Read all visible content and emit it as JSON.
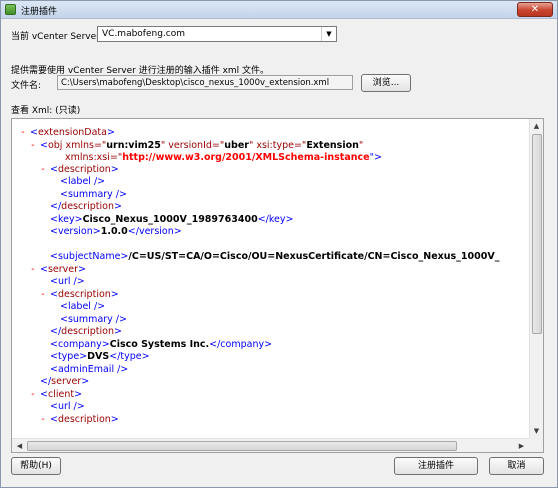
{
  "window": {
    "title": "注册插件",
    "close_glyph": "✕"
  },
  "server": {
    "label": "当前 vCenter Server:",
    "value": "VC.mabofeng.com"
  },
  "hint": "提供需要使用 vCenter Server 进行注册的输入插件 xml 文件。",
  "file": {
    "label": "文件名:",
    "path": "C:\\Users\\mabofeng\\Desktop\\cisco_nexus_1000v_extension.xml",
    "browse_label": "浏览..."
  },
  "view_label": "查看 Xml: (只读)",
  "xml_lines": [
    {
      "minus": "-",
      "tags": [
        "<",
        "extensionData",
        ">"
      ]
    },
    {
      "minus": "-",
      "obj": {
        "open": "<",
        "name": "obj",
        "a1": " xmlns=\"",
        "v1": "urn:vim25",
        "a2": "\" versionId=\"",
        "v2": "uber",
        "a3": "\" xsi:type=\"",
        "v3": "Extension",
        "end": "\""
      }
    },
    {
      "xmlns_xsi": {
        "attr": "xmlns:xsi=\"",
        "value": "http://www.w3.org/2001/XMLSchema-instance",
        "end": "\">"
      }
    },
    {
      "minus": "-",
      "tags": [
        "<",
        "description",
        ">"
      ]
    },
    {
      "text": "<label />"
    },
    {
      "text": "<summary />"
    },
    {
      "tags": [
        "</",
        "description",
        ">"
      ]
    },
    {
      "key": {
        "open": "<key>",
        "value": "Cisco_Nexus_1000V_1989763400",
        "close": "</key>"
      }
    },
    {
      "key": {
        "open": "<version>",
        "value": "1.0.0",
        "close": "</version>"
      }
    },
    {
      "key": {
        "open": "<subjectName>",
        "value": "/C=US/ST=CA/O=Cisco/OU=NexusCertificate/CN=Cisco_Nexus_1000V_",
        "close": ""
      }
    },
    {
      "minus": "-",
      "tags": [
        "<",
        "server",
        ">"
      ]
    },
    {
      "text": "<url />"
    },
    {
      "minus": "-",
      "tags": [
        "<",
        "description",
        ">"
      ]
    },
    {
      "text": "<label />"
    },
    {
      "text": "<summary />"
    },
    {
      "tags": [
        "</",
        "description",
        ">"
      ]
    },
    {
      "key": {
        "open": "<company>",
        "value": "Cisco Systems Inc.",
        "close": "</company>"
      }
    },
    {
      "key": {
        "open": "<type>",
        "value": "DVS",
        "close": "</type>"
      }
    },
    {
      "text": "<adminEmail />"
    },
    {
      "tags": [
        "</",
        "server",
        ">"
      ]
    },
    {
      "minus": "-",
      "tags": [
        "<",
        "client",
        ">"
      ]
    },
    {
      "text": "<url />"
    },
    {
      "minus": "-",
      "tags": [
        "<",
        "description",
        ">"
      ]
    }
  ],
  "scroll": {
    "up": "▲",
    "down": "▼",
    "left": "◀",
    "right": "▶"
  },
  "buttons": {
    "help": "帮助(H)",
    "register": "注册插件",
    "cancel": "取消"
  }
}
